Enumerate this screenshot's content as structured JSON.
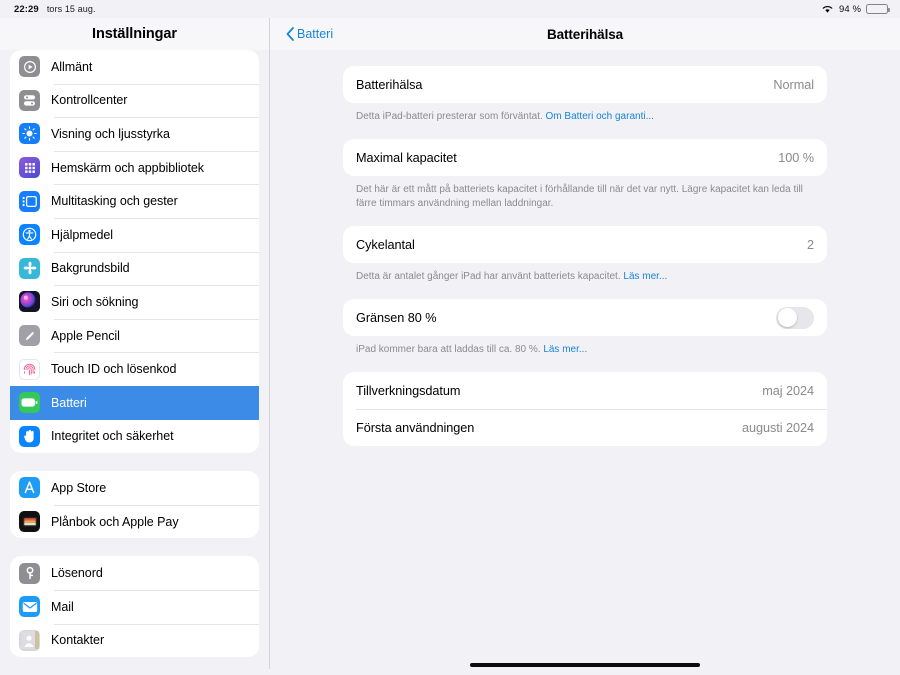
{
  "statusbar": {
    "time": "22:29",
    "date": "tors 15 aug.",
    "battery_percent": "94 %",
    "wifi_icon": "wifi-icon",
    "battery_icon": "battery-icon"
  },
  "sidebar": {
    "title": "Inställningar",
    "groups": [
      {
        "items": [
          {
            "label": "Allmänt",
            "icon": "general-gear-icon",
            "icon_class": "ic-gray",
            "selected": false
          },
          {
            "label": "Kontrollcenter",
            "icon": "control-center-icon",
            "icon_class": "ic-gray",
            "selected": false
          },
          {
            "label": "Visning och ljusstyrka",
            "icon": "display-brightness-icon",
            "icon_class": "ic-blue",
            "selected": false
          },
          {
            "label": "Hemskärm och appbibliotek",
            "icon": "home-screen-icon",
            "icon_class": "ic-purple",
            "selected": false
          },
          {
            "label": "Multitasking och gester",
            "icon": "multitasking-icon",
            "icon_class": "ic-blue",
            "selected": false
          },
          {
            "label": "Hjälpmedel",
            "icon": "accessibility-icon",
            "icon_class": "ic-blue2",
            "selected": false
          },
          {
            "label": "Bakgrundsbild",
            "icon": "wallpaper-icon",
            "icon_class": "ic-teal",
            "selected": false
          },
          {
            "label": "Siri och sökning",
            "icon": "siri-icon",
            "icon_class": "ic-dark",
            "selected": false
          },
          {
            "label": "Apple Pencil",
            "icon": "apple-pencil-icon",
            "icon_class": "ic-lgray",
            "selected": false
          },
          {
            "label": "Touch ID och lösenkod",
            "icon": "touch-id-icon",
            "icon_class": "ic-white",
            "selected": false
          },
          {
            "label": "Batteri",
            "icon": "battery-settings-icon",
            "icon_class": "ic-green",
            "selected": true
          },
          {
            "label": "Integritet och säkerhet",
            "icon": "privacy-hand-icon",
            "icon_class": "ic-blue2",
            "selected": false
          }
        ]
      },
      {
        "items": [
          {
            "label": "App Store",
            "icon": "app-store-icon",
            "icon_class": "ic-appst",
            "selected": false
          },
          {
            "label": "Plånbok och Apple Pay",
            "icon": "wallet-icon",
            "icon_class": "ic-black",
            "selected": false
          }
        ]
      },
      {
        "items": [
          {
            "label": "Lösenord",
            "icon": "passwords-key-icon",
            "icon_class": "ic-gray",
            "selected": false
          },
          {
            "label": "Mail",
            "icon": "mail-icon",
            "icon_class": "ic-mail",
            "selected": false
          },
          {
            "label": "Kontakter",
            "icon": "contacts-icon",
            "icon_class": "ic-kont",
            "selected": false
          }
        ]
      }
    ]
  },
  "detail": {
    "back_label": "Batteri",
    "back_icon": "chevron-left-icon",
    "title": "Batterihälsa",
    "sections": [
      {
        "rows": [
          {
            "label": "Batterihälsa",
            "value": "Normal"
          }
        ],
        "footnote_text": "Detta iPad-batteri presterar som förväntat. ",
        "footnote_link": "Om Batteri och garanti..."
      },
      {
        "rows": [
          {
            "label": "Maximal kapacitet",
            "value": "100 %"
          }
        ],
        "footnote_text": "Det här är ett mått på batteriets kapacitet i förhållande till när det var nytt. Lägre kapacitet kan leda till färre timmars användning mellan laddningar.",
        "footnote_link": ""
      },
      {
        "rows": [
          {
            "label": "Cykelantal",
            "value": "2"
          }
        ],
        "footnote_text": "Detta är antalet gånger iPad har använt batteriets kapacitet. ",
        "footnote_link": "Läs mer..."
      },
      {
        "rows": [
          {
            "label": "Gränsen 80 %",
            "value": "",
            "toggle": true,
            "toggle_on": false
          }
        ],
        "footnote_text": "iPad kommer bara att laddas till ca. 80 %. ",
        "footnote_link": "Läs mer..."
      },
      {
        "rows": [
          {
            "label": "Tillverkningsdatum",
            "value": "maj 2024"
          },
          {
            "label": "Första användningen",
            "value": "augusti 2024"
          }
        ],
        "footnote_text": "",
        "footnote_link": ""
      }
    ]
  },
  "colors": {
    "accent": "#1785d8",
    "selection": "#3c8ce7",
    "background": "#f1f1f6",
    "card": "#ffffff",
    "secondary_text": "#8a8a8f"
  }
}
